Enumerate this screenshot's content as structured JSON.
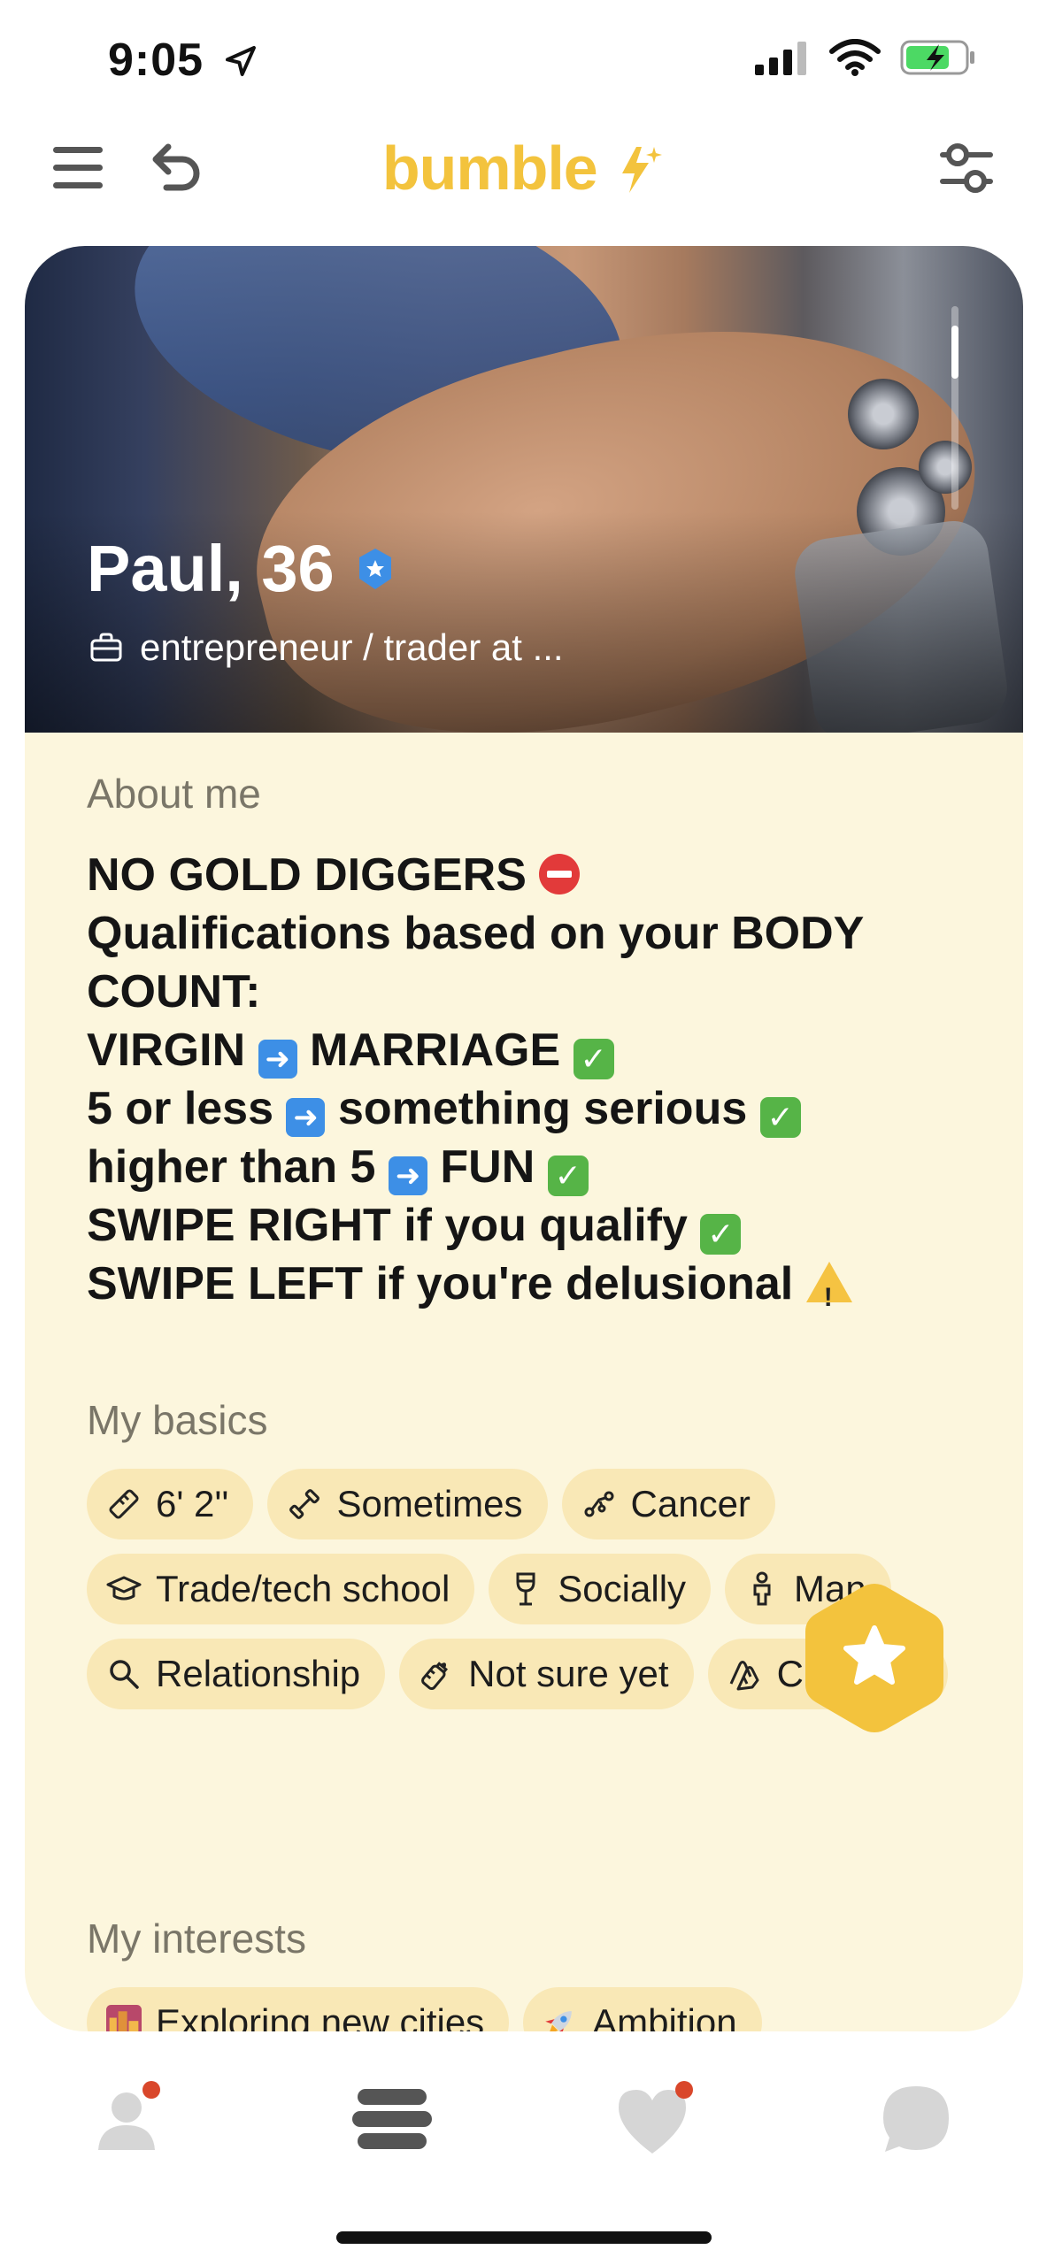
{
  "status_bar": {
    "time": "9:05"
  },
  "header": {
    "logo": "bumble"
  },
  "profile": {
    "name": "Paul, 36",
    "job": "entrepreneur / trader at ..."
  },
  "about": {
    "title": "About me",
    "lines": {
      "l1": "NO GOLD DIGGERS",
      "l2": "Qualifications based on your BODY",
      "l3": "COUNT:",
      "l4a": "VIRGIN",
      "l4b": "MARRIAGE",
      "l5a": "5 or less",
      "l5b": "something serious",
      "l6a": "higher than 5",
      "l6b": "FUN",
      "l7": "SWIPE RIGHT if you qualify",
      "l8": "SWIPE LEFT if you're delusional"
    }
  },
  "basics": {
    "title": "My basics",
    "chips": [
      {
        "label": "6' 2''",
        "icon": "ruler-icon"
      },
      {
        "label": "Sometimes",
        "icon": "dumbbell-icon"
      },
      {
        "label": "Cancer",
        "icon": "zodiac-icon"
      },
      {
        "label": "Trade/tech school",
        "icon": "graduation-cap-icon"
      },
      {
        "label": "Socially",
        "icon": "wine-glass-icon"
      },
      {
        "label": "Man",
        "icon": "person-icon"
      },
      {
        "label": "Relationship",
        "icon": "magnifier-icon"
      },
      {
        "label": "Not sure yet",
        "icon": "baby-bottle-icon"
      },
      {
        "label": "Christian",
        "icon": "praying-hands-icon"
      }
    ]
  },
  "interests": {
    "title": "My interests",
    "chips": [
      {
        "label": "Exploring new cities",
        "icon": "cityscape-emoji"
      },
      {
        "label": "Ambition",
        "icon": "rocket-emoji"
      }
    ]
  },
  "colors": {
    "brand": "#f3c33d",
    "card_bg": "#fcf6dd",
    "chip_bg": "#f9e8b6",
    "notification": "#d9472b"
  }
}
